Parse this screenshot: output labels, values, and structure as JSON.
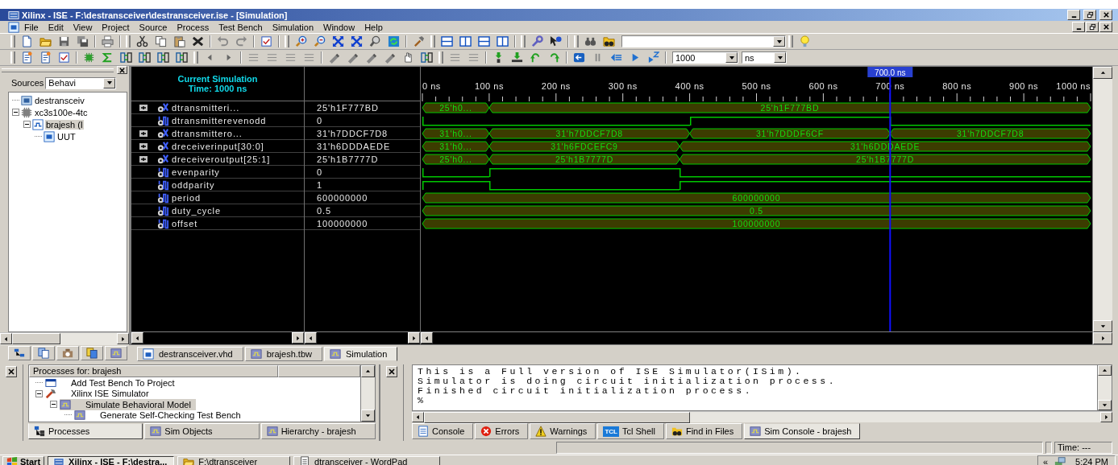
{
  "window": {
    "title": "Xilinx - ISE - F:\\destransceiver\\destransceiver.ise - [Simulation]"
  },
  "menu": [
    "File",
    "Edit",
    "View",
    "Project",
    "Source",
    "Process",
    "Test Bench",
    "Simulation",
    "Window",
    "Help"
  ],
  "toolbar": {
    "run_time": "1000",
    "time_unit": "ns"
  },
  "sources": {
    "label": "Sources",
    "view": "Behavi",
    "tree": [
      {
        "label": "destransceiv",
        "kind": "project",
        "selected": false
      },
      {
        "label": "xc3s100e-4tc",
        "kind": "chip",
        "selected": false,
        "expanded": true,
        "children": [
          {
            "label": "brajesh (I",
            "kind": "testbench",
            "selected": true,
            "expanded": true,
            "children": [
              {
                "label": "UUT",
                "kind": "module",
                "selected": false
              }
            ]
          }
        ]
      }
    ]
  },
  "waveform": {
    "header": [
      "Current Simulation",
      "Time: 1000 ns"
    ],
    "cursor": {
      "label": "700.0 ns"
    },
    "time_scale": [
      "0 ns",
      "100 ns",
      "200 ns",
      "300 ns",
      "400 ns",
      "500 ns",
      "600 ns",
      "700 ns",
      "800 ns",
      "900 ns",
      "1000 ns"
    ],
    "signals": [
      {
        "name": "dtransmitteri...",
        "value": "25'h1F777BD",
        "kind": "bus",
        "expandable": true,
        "segments": [
          {
            "label": "25'h0..."
          },
          {
            "label": "25'h1F777BD"
          }
        ]
      },
      {
        "name": "dtransmitterevenodd",
        "value": "0",
        "kind": "bit",
        "expandable": false,
        "segments": [
          {
            "high": false
          },
          {
            "high": true
          },
          {
            "high": false
          }
        ]
      },
      {
        "name": "dtransmittero...",
        "value": "31'h7DDCF7D8",
        "kind": "bus",
        "expandable": true,
        "segments": [
          {
            "label": "31'h0..."
          },
          {
            "label": "31'h7DDCF7D8"
          },
          {
            "label": "31'h7DDDF6CF"
          },
          {
            "label": "31'h7DDCF7D8"
          }
        ]
      },
      {
        "name": "dreceiverinput[30:0]",
        "value": "31'h6DDDAEDE",
        "kind": "bus",
        "expandable": true,
        "segments": [
          {
            "label": "31'h0..."
          },
          {
            "label": "31'h6FDCEFC9"
          },
          {
            "label": "31'h6DDDAEDE"
          }
        ]
      },
      {
        "name": "dreceiveroutput[25:1]",
        "value": "25'h1B7777D",
        "kind": "bus",
        "expandable": true,
        "segments": [
          {
            "label": "25'h0..."
          },
          {
            "label": "25'h1B7777D"
          },
          {
            "label": "25'h1B7777D"
          }
        ]
      },
      {
        "name": "evenparity",
        "value": "0",
        "kind": "bit",
        "expandable": false,
        "segments": [
          {
            "high": false
          },
          {
            "high": true
          },
          {
            "high": false
          }
        ]
      },
      {
        "name": "oddparity",
        "value": "1",
        "kind": "bit",
        "expandable": false,
        "segments": [
          {
            "high": true
          },
          {
            "high": false
          },
          {
            "high": true
          }
        ]
      },
      {
        "name": "period",
        "value": "600000000",
        "kind": "bus",
        "expandable": false,
        "segments": [
          {
            "label": "600000000"
          }
        ]
      },
      {
        "name": "duty_cycle",
        "value": "0.5",
        "kind": "bus",
        "expandable": false,
        "segments": [
          {
            "label": "0.5"
          }
        ]
      },
      {
        "name": "offset",
        "value": "100000000",
        "kind": "bus",
        "expandable": false,
        "segments": [
          {
            "label": "100000000"
          }
        ]
      }
    ]
  },
  "editor_tabs": [
    {
      "label": "destransceiver.vhd",
      "kind": "vhdl",
      "selected": false
    },
    {
      "label": "brajesh.tbw",
      "kind": "wave",
      "selected": false
    },
    {
      "label": "Simulation",
      "kind": "wave",
      "selected": true
    }
  ],
  "processes": {
    "header": "Processes for: brajesh",
    "items": [
      {
        "label": "Add Test Bench To Project",
        "kind": "action",
        "selected": false
      },
      {
        "label": "Xilinx ISE Simulator",
        "kind": "tool",
        "selected": false,
        "expanded": true,
        "children": [
          {
            "label": "Simulate Behavioral Model",
            "kind": "wave",
            "selected": true,
            "expanded": true,
            "children": [
              {
                "label": "Generate Self-Checking Test Bench",
                "kind": "wave",
                "selected": false
              }
            ]
          }
        ]
      }
    ]
  },
  "panel_tabs": [
    {
      "label": "Processes",
      "kind": "processes",
      "selected": true
    },
    {
      "label": "Sim Objects",
      "kind": "wave",
      "selected": false
    },
    {
      "label": "Hierarchy - brajesh",
      "kind": "wave",
      "selected": false
    }
  ],
  "console": {
    "lines": [
      "This is a Full version of ISE Simulator(ISim).",
      "Simulator is doing circuit initialization process.",
      "Finished circuit initialization process.",
      "%"
    ],
    "tabs": [
      {
        "label": "Console",
        "kind": "console",
        "selected": false
      },
      {
        "label": "Errors",
        "kind": "errors",
        "selected": false
      },
      {
        "label": "Warnings",
        "kind": "warnings",
        "selected": false
      },
      {
        "label": "Tcl Shell",
        "kind": "tcl",
        "badge": "TCL",
        "selected": false
      },
      {
        "label": "Find in Files",
        "kind": "find",
        "selected": false
      },
      {
        "label": "Sim Console - brajesh",
        "kind": "wave",
        "selected": true
      }
    ]
  },
  "status_bar": {
    "time": "Time: ---"
  },
  "taskbar": {
    "start": "Start",
    "tasks": [
      {
        "label": "Xilinx - ISE - F:\\destra...",
        "kind": "ise",
        "selected": true
      },
      {
        "label": "F:\\dtransceiver",
        "kind": "folder",
        "selected": false
      },
      {
        "label": "dtransceiver - WordPad",
        "kind": "wordpad",
        "selected": false
      }
    ],
    "tray_toggle": "«",
    "clock": "5:24 PM"
  }
}
